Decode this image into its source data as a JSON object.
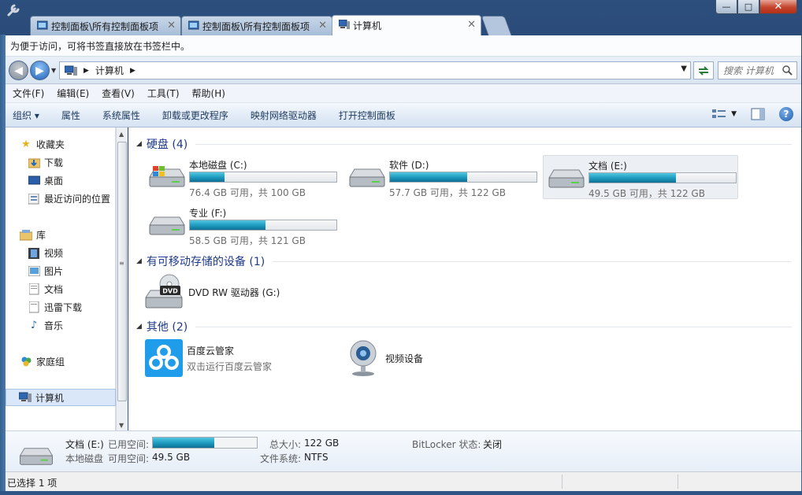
{
  "tabs": [
    {
      "label": "控制面板\\所有控制面板项"
    },
    {
      "label": "控制面板\\所有控制面板项"
    },
    {
      "label": "计算机"
    }
  ],
  "window": {
    "min": "—",
    "max": "□",
    "close": "✕"
  },
  "bookmark_bar": {
    "text": "为便于访问，可将书签直接放在书签栏中。"
  },
  "address": {
    "path": "计算机",
    "search_placeholder": "搜索 计算机"
  },
  "menu": [
    "文件(F)",
    "编辑(E)",
    "查看(V)",
    "工具(T)",
    "帮助(H)"
  ],
  "commands": [
    "组织 ▾",
    "属性",
    "系统属性",
    "卸载或更改程序",
    "映射网络驱动器",
    "打开控制面板"
  ],
  "nav": {
    "favorites": "收藏夹",
    "downloads": "下载",
    "desktop": "桌面",
    "recent": "最近访问的位置",
    "libraries": "库",
    "videos": "视频",
    "pictures": "图片",
    "documents": "文档",
    "thunder": "迅雷下载",
    "music": "音乐",
    "homegroup": "家庭组",
    "computer": "计算机"
  },
  "groups": {
    "hdd": "硬盘 (4)",
    "removable": "有可移动存储的设备 (1)",
    "other": "其他 (2)"
  },
  "drives": [
    {
      "name": "本地磁盘 (C:)",
      "space": "76.4 GB 可用，共 100 GB",
      "used_fraction": 0.236
    },
    {
      "name": "软件 (D:)",
      "space": "57.7 GB 可用，共 122 GB",
      "used_fraction": 0.527
    },
    {
      "name": "文档 (E:)",
      "space": "49.5 GB 可用，共 122 GB",
      "used_fraction": 0.594
    },
    {
      "name": "专业 (F:)",
      "space": "58.5 GB 可用，共 121 GB",
      "used_fraction": 0.517
    }
  ],
  "removable": {
    "name": "DVD RW 驱动器 (G:)",
    "icon_text": "DVD"
  },
  "other": [
    {
      "name": "百度云管家",
      "sub": "双击运行百度云管家"
    },
    {
      "name": "视频设备"
    }
  ],
  "details": {
    "name": "文档 (E:)",
    "type": "本地磁盘",
    "used_label": "已用空间:",
    "free_label": "可用空间:",
    "free_value": "49.5 GB",
    "total_label": "总大小:",
    "total_value": "122 GB",
    "fs_label": "文件系统:",
    "fs_value": "NTFS",
    "bitlocker_label": "BitLocker 状态:",
    "bitlocker_value": "关闭",
    "used_fraction": 0.594
  },
  "status": {
    "text": "已选择 1 项"
  }
}
